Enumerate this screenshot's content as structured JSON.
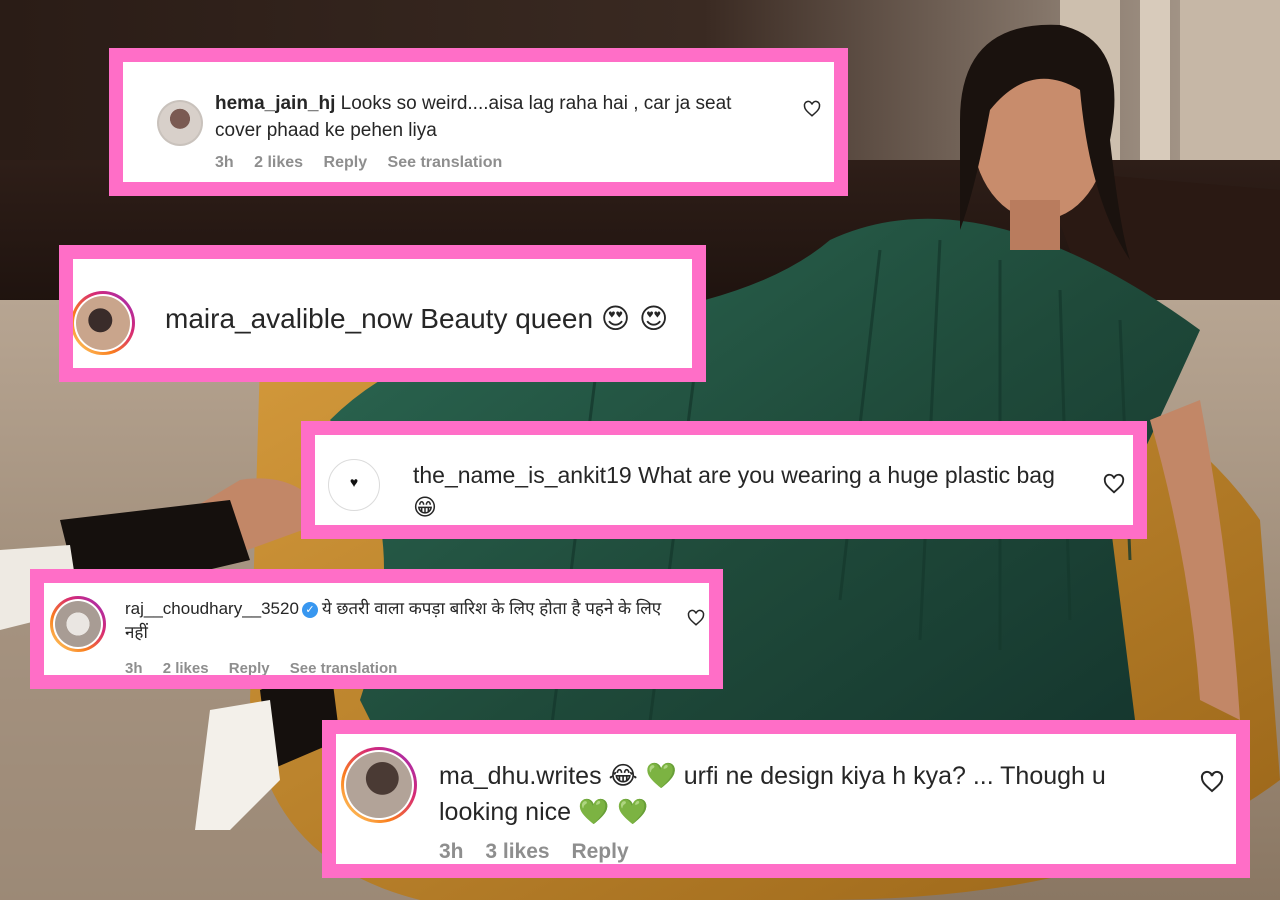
{
  "comments": [
    {
      "username": "hema_jain_hj",
      "text": "Looks so weird....aisa lag raha hai , car ja seat cover phaad ke pehen liya",
      "time": "3h",
      "likes": "2 likes",
      "reply": "Reply",
      "translate": "See translation"
    },
    {
      "username": "maira_avalible_now",
      "text": "Beauty queen",
      "emoji": "😍 😍"
    },
    {
      "username": "the_name_is_ankit19",
      "text": "What are you wearing a huge plastic bag",
      "emoji": "😁"
    },
    {
      "username": "raj__choudhary__3520",
      "text": "ये छतरी वाला कपड़ा बारिश के लिए होता है पहने के लिए नहीं",
      "time": "3h",
      "likes": "2 likes",
      "reply": "Reply",
      "translate": "See translation"
    },
    {
      "username": "ma_dhu.writes",
      "emoji_a": "😂 💚",
      "text": "urfi ne design kiya h kya? ... Though u looking nice",
      "emoji_b": "💚 💚",
      "time": "3h",
      "likes": "3 likes",
      "reply": "Reply"
    }
  ],
  "colors": {
    "frame": "#ff6ec7",
    "dress": "#1f4a3a",
    "beanbag": "#c98a2a",
    "muted_text": "#8e8e8e"
  },
  "icons": [
    "heart-outline-icon",
    "verified-badge-icon",
    "avatar"
  ]
}
